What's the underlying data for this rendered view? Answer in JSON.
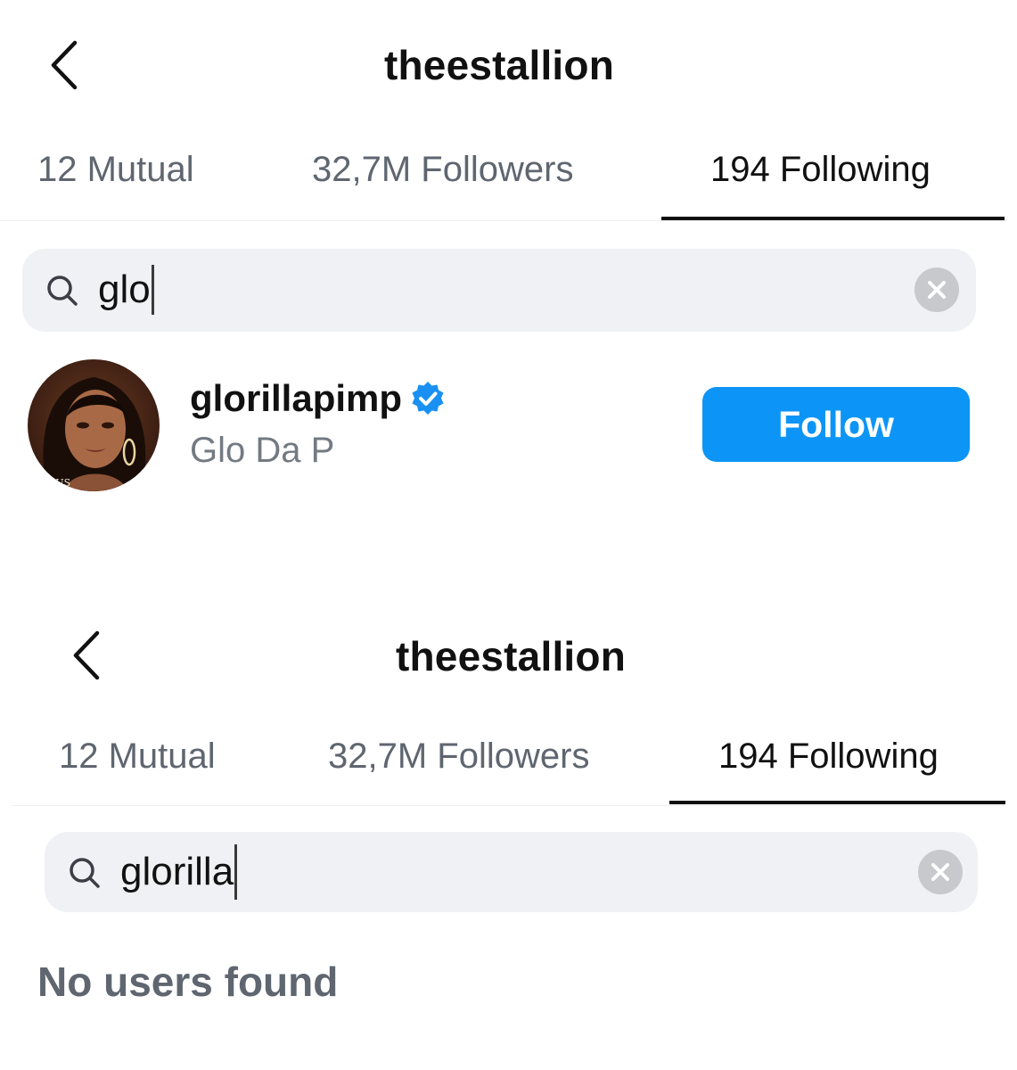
{
  "screen1": {
    "header": {
      "title": "theestallion"
    },
    "tabs": [
      {
        "label": "12 Mutual",
        "active": false
      },
      {
        "label": "32,7M Followers",
        "active": false
      },
      {
        "label": "194 Following",
        "active": true
      }
    ],
    "search": {
      "value": "glo",
      "icons": [
        "search-icon",
        "clear-icon"
      ]
    },
    "results": [
      {
        "username": "glorillapimp",
        "verified": true,
        "full_name": "Glo Da P",
        "button_label": "Follow"
      }
    ]
  },
  "screen2": {
    "header": {
      "title": "theestallion"
    },
    "tabs": [
      {
        "label": "12 Mutual",
        "active": false
      },
      {
        "label": "32,7M Followers",
        "active": false
      },
      {
        "label": "194 Following",
        "active": true
      }
    ],
    "search": {
      "value": "glorilla",
      "icons": [
        "search-icon",
        "clear-icon"
      ]
    },
    "empty_message": "No users found"
  },
  "colors": {
    "follow_button": "#0c95f6",
    "verified_badge": "#1a91f2",
    "search_bg": "#eff1f4",
    "inactive_tab": "#5f6670"
  }
}
